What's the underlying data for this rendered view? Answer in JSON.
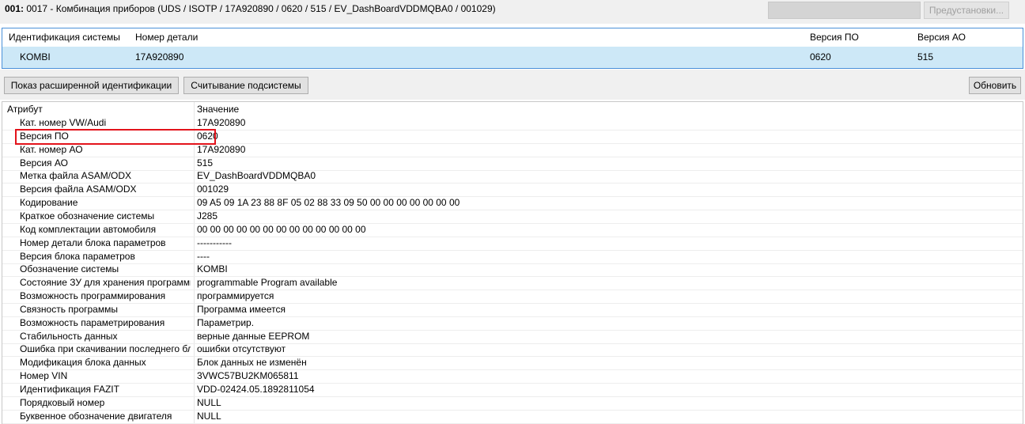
{
  "header": {
    "id": "001:",
    "title": " 0017 - Комбинация приборов  (UDS / ISOTP / 17A920890 / 0620 / 515 / EV_DashBoardVDDMQBA0 / 001029)",
    "presets_label": "Предустановки..."
  },
  "system_table": {
    "headers": [
      "Идентификация системы",
      "Номер детали",
      "Версия ПО",
      "Версия АО"
    ],
    "row": [
      "KOMBI",
      "17A920890",
      "0620",
      "515"
    ]
  },
  "toolbar": {
    "extended_id_label": "Показ расширенной идентификации",
    "subsystem_label": "Считывание подсистемы",
    "refresh_label": "Обновить"
  },
  "attributes": {
    "header_attr": "Атрибут",
    "header_value": "Значение",
    "rows": [
      {
        "attr": "Кат. номер VW/Audi",
        "value": "17A920890"
      },
      {
        "attr": "Версия ПО",
        "value": "0620"
      },
      {
        "attr": "Кат. номер АО",
        "value": "17A920890"
      },
      {
        "attr": "Версия АО",
        "value": "515"
      },
      {
        "attr": "Метка файла ASAM/ODX",
        "value": "EV_DashBoardVDDMQBA0"
      },
      {
        "attr": "Версия файла ASAM/ODX",
        "value": "001029"
      },
      {
        "attr": "Кодирование",
        "value": "09 A5 09 1A 23 88 8F 05 02 88 33 09 50 00 00 00 00 00 00 00"
      },
      {
        "attr": "Краткое обозначение системы",
        "value": "J285"
      },
      {
        "attr": "Код комплектации автомобиля",
        "value": "00 00 00 00 00 00 00 00 00 00 00 00 00"
      },
      {
        "attr": "Номер детали блока параметров",
        "value": "-----------"
      },
      {
        "attr": "Версия блока параметров",
        "value": "----"
      },
      {
        "attr": "Обозначение системы",
        "value": "KOMBI"
      },
      {
        "attr": "Состояние ЗУ для хранения программы",
        "value": "programmable Program available"
      },
      {
        "attr": "Возможность программирования",
        "value": "программируется"
      },
      {
        "attr": "Связность программы",
        "value": "Программа имеется"
      },
      {
        "attr": "Возможность параметрирования",
        "value": "Параметрир."
      },
      {
        "attr": "Стабильность данных",
        "value": "верные данные EEPROM"
      },
      {
        "attr": "Ошибка при скачивании последнего блока",
        "value": "ошибки отсутствуют"
      },
      {
        "attr": "Модификация блока данных",
        "value": "Блок данных не изменён"
      },
      {
        "attr": "Номер VIN",
        "value": "3VWC57BU2KM065811"
      },
      {
        "attr": "Идентификация FAZIT",
        "value": "VDD-02424.05.1892811054"
      },
      {
        "attr": "Порядковый номер",
        "value": "NULL"
      },
      {
        "attr": "Буквенное обозначение двигателя",
        "value": "NULL"
      }
    ]
  },
  "colors": {
    "selection": "#cde8f7",
    "highlight_box": "#e3131b",
    "table_border": "#4a90d9"
  }
}
